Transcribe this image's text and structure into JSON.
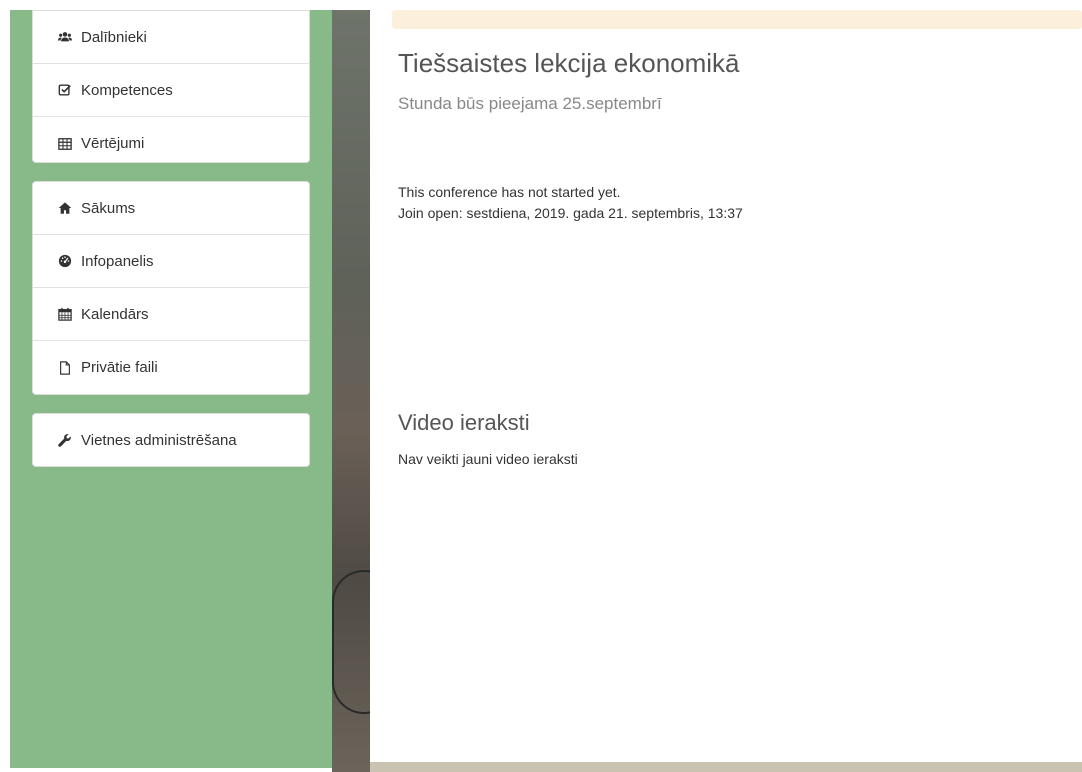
{
  "sidebar": {
    "groups": [
      {
        "items": [
          {
            "label": "Dalībnieki",
            "icon": "users-icon"
          },
          {
            "label": "Kompetences",
            "icon": "check-square-icon"
          },
          {
            "label": "Vērtējumi",
            "icon": "table-icon"
          }
        ]
      },
      {
        "items": [
          {
            "label": "Sākums",
            "icon": "home-icon"
          },
          {
            "label": "Infopanelis",
            "icon": "dashboard-icon"
          },
          {
            "label": "Kalendārs",
            "icon": "calendar-icon"
          },
          {
            "label": "Privātie faili",
            "icon": "file-icon"
          }
        ]
      },
      {
        "items": [
          {
            "label": "Vietnes administrēšana",
            "icon": "wrench-icon"
          }
        ]
      }
    ]
  },
  "main": {
    "title": "Tiešsaistes lekcija ekonomikā",
    "subtitle": "Stunda būs pieejama 25.septembrī",
    "conference_status": "This conference has not started yet.",
    "join_open": "Join open: sestdiena, 2019. gada 21. septembris, 13:37",
    "recordings_title": "Video ieraksti",
    "recordings_empty": "Nav veikti jauni video ieraksti"
  },
  "colors": {
    "sidebar_bg": "#88b988",
    "notice_bg": "#fcefdc",
    "icon_color": "#333333"
  }
}
